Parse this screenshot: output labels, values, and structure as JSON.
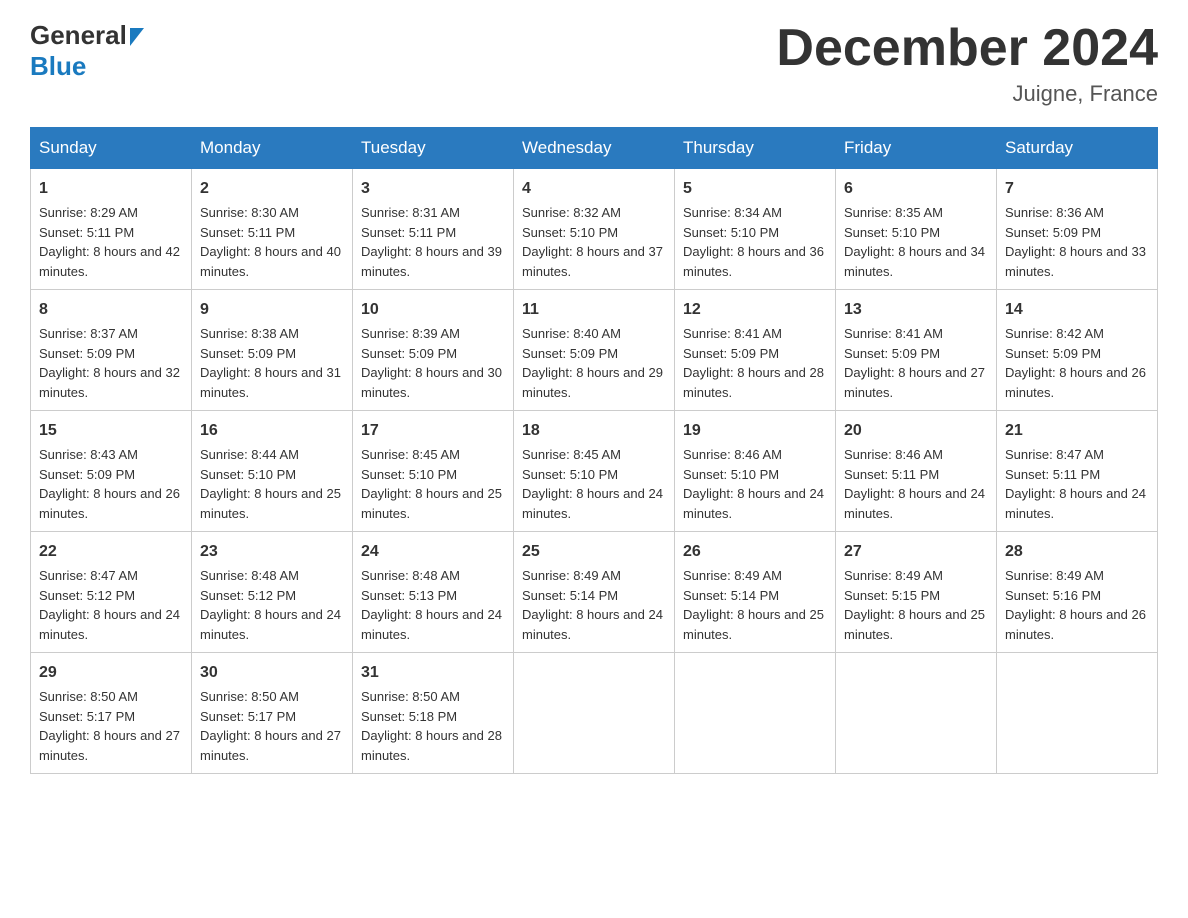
{
  "header": {
    "logo_general": "General",
    "logo_blue": "Blue",
    "month_title": "December 2024",
    "location": "Juigne, France"
  },
  "days_of_week": [
    "Sunday",
    "Monday",
    "Tuesday",
    "Wednesday",
    "Thursday",
    "Friday",
    "Saturday"
  ],
  "weeks": [
    [
      {
        "day": "1",
        "sunrise": "8:29 AM",
        "sunset": "5:11 PM",
        "daylight": "8 hours and 42 minutes."
      },
      {
        "day": "2",
        "sunrise": "8:30 AM",
        "sunset": "5:11 PM",
        "daylight": "8 hours and 40 minutes."
      },
      {
        "day": "3",
        "sunrise": "8:31 AM",
        "sunset": "5:11 PM",
        "daylight": "8 hours and 39 minutes."
      },
      {
        "day": "4",
        "sunrise": "8:32 AM",
        "sunset": "5:10 PM",
        "daylight": "8 hours and 37 minutes."
      },
      {
        "day": "5",
        "sunrise": "8:34 AM",
        "sunset": "5:10 PM",
        "daylight": "8 hours and 36 minutes."
      },
      {
        "day": "6",
        "sunrise": "8:35 AM",
        "sunset": "5:10 PM",
        "daylight": "8 hours and 34 minutes."
      },
      {
        "day": "7",
        "sunrise": "8:36 AM",
        "sunset": "5:09 PM",
        "daylight": "8 hours and 33 minutes."
      }
    ],
    [
      {
        "day": "8",
        "sunrise": "8:37 AM",
        "sunset": "5:09 PM",
        "daylight": "8 hours and 32 minutes."
      },
      {
        "day": "9",
        "sunrise": "8:38 AM",
        "sunset": "5:09 PM",
        "daylight": "8 hours and 31 minutes."
      },
      {
        "day": "10",
        "sunrise": "8:39 AM",
        "sunset": "5:09 PM",
        "daylight": "8 hours and 30 minutes."
      },
      {
        "day": "11",
        "sunrise": "8:40 AM",
        "sunset": "5:09 PM",
        "daylight": "8 hours and 29 minutes."
      },
      {
        "day": "12",
        "sunrise": "8:41 AM",
        "sunset": "5:09 PM",
        "daylight": "8 hours and 28 minutes."
      },
      {
        "day": "13",
        "sunrise": "8:41 AM",
        "sunset": "5:09 PM",
        "daylight": "8 hours and 27 minutes."
      },
      {
        "day": "14",
        "sunrise": "8:42 AM",
        "sunset": "5:09 PM",
        "daylight": "8 hours and 26 minutes."
      }
    ],
    [
      {
        "day": "15",
        "sunrise": "8:43 AM",
        "sunset": "5:09 PM",
        "daylight": "8 hours and 26 minutes."
      },
      {
        "day": "16",
        "sunrise": "8:44 AM",
        "sunset": "5:10 PM",
        "daylight": "8 hours and 25 minutes."
      },
      {
        "day": "17",
        "sunrise": "8:45 AM",
        "sunset": "5:10 PM",
        "daylight": "8 hours and 25 minutes."
      },
      {
        "day": "18",
        "sunrise": "8:45 AM",
        "sunset": "5:10 PM",
        "daylight": "8 hours and 24 minutes."
      },
      {
        "day": "19",
        "sunrise": "8:46 AM",
        "sunset": "5:10 PM",
        "daylight": "8 hours and 24 minutes."
      },
      {
        "day": "20",
        "sunrise": "8:46 AM",
        "sunset": "5:11 PM",
        "daylight": "8 hours and 24 minutes."
      },
      {
        "day": "21",
        "sunrise": "8:47 AM",
        "sunset": "5:11 PM",
        "daylight": "8 hours and 24 minutes."
      }
    ],
    [
      {
        "day": "22",
        "sunrise": "8:47 AM",
        "sunset": "5:12 PM",
        "daylight": "8 hours and 24 minutes."
      },
      {
        "day": "23",
        "sunrise": "8:48 AM",
        "sunset": "5:12 PM",
        "daylight": "8 hours and 24 minutes."
      },
      {
        "day": "24",
        "sunrise": "8:48 AM",
        "sunset": "5:13 PM",
        "daylight": "8 hours and 24 minutes."
      },
      {
        "day": "25",
        "sunrise": "8:49 AM",
        "sunset": "5:14 PM",
        "daylight": "8 hours and 24 minutes."
      },
      {
        "day": "26",
        "sunrise": "8:49 AM",
        "sunset": "5:14 PM",
        "daylight": "8 hours and 25 minutes."
      },
      {
        "day": "27",
        "sunrise": "8:49 AM",
        "sunset": "5:15 PM",
        "daylight": "8 hours and 25 minutes."
      },
      {
        "day": "28",
        "sunrise": "8:49 AM",
        "sunset": "5:16 PM",
        "daylight": "8 hours and 26 minutes."
      }
    ],
    [
      {
        "day": "29",
        "sunrise": "8:50 AM",
        "sunset": "5:17 PM",
        "daylight": "8 hours and 27 minutes."
      },
      {
        "day": "30",
        "sunrise": "8:50 AM",
        "sunset": "5:17 PM",
        "daylight": "8 hours and 27 minutes."
      },
      {
        "day": "31",
        "sunrise": "8:50 AM",
        "sunset": "5:18 PM",
        "daylight": "8 hours and 28 minutes."
      },
      null,
      null,
      null,
      null
    ]
  ]
}
